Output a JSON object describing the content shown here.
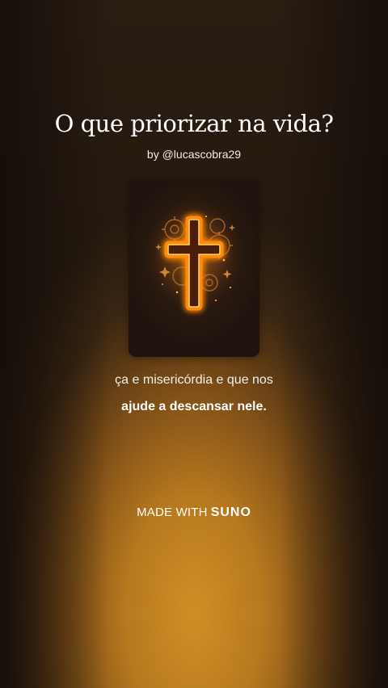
{
  "song": {
    "title": "O que priorizar na vida?",
    "byline": "by @lucascobra29"
  },
  "cover": {
    "icon": "glowing-cross-icon",
    "glow_color": "#ff9a1a",
    "core_color": "#ffe27a"
  },
  "lyrics": {
    "line1": "ça e misericórdia e que nos",
    "line2": "ajude a descansar nele."
  },
  "watermark": {
    "prefix": "MADE WITH",
    "brand": "SUNO"
  },
  "colors": {
    "accent": "#cf8f26",
    "background": "#24190f"
  }
}
